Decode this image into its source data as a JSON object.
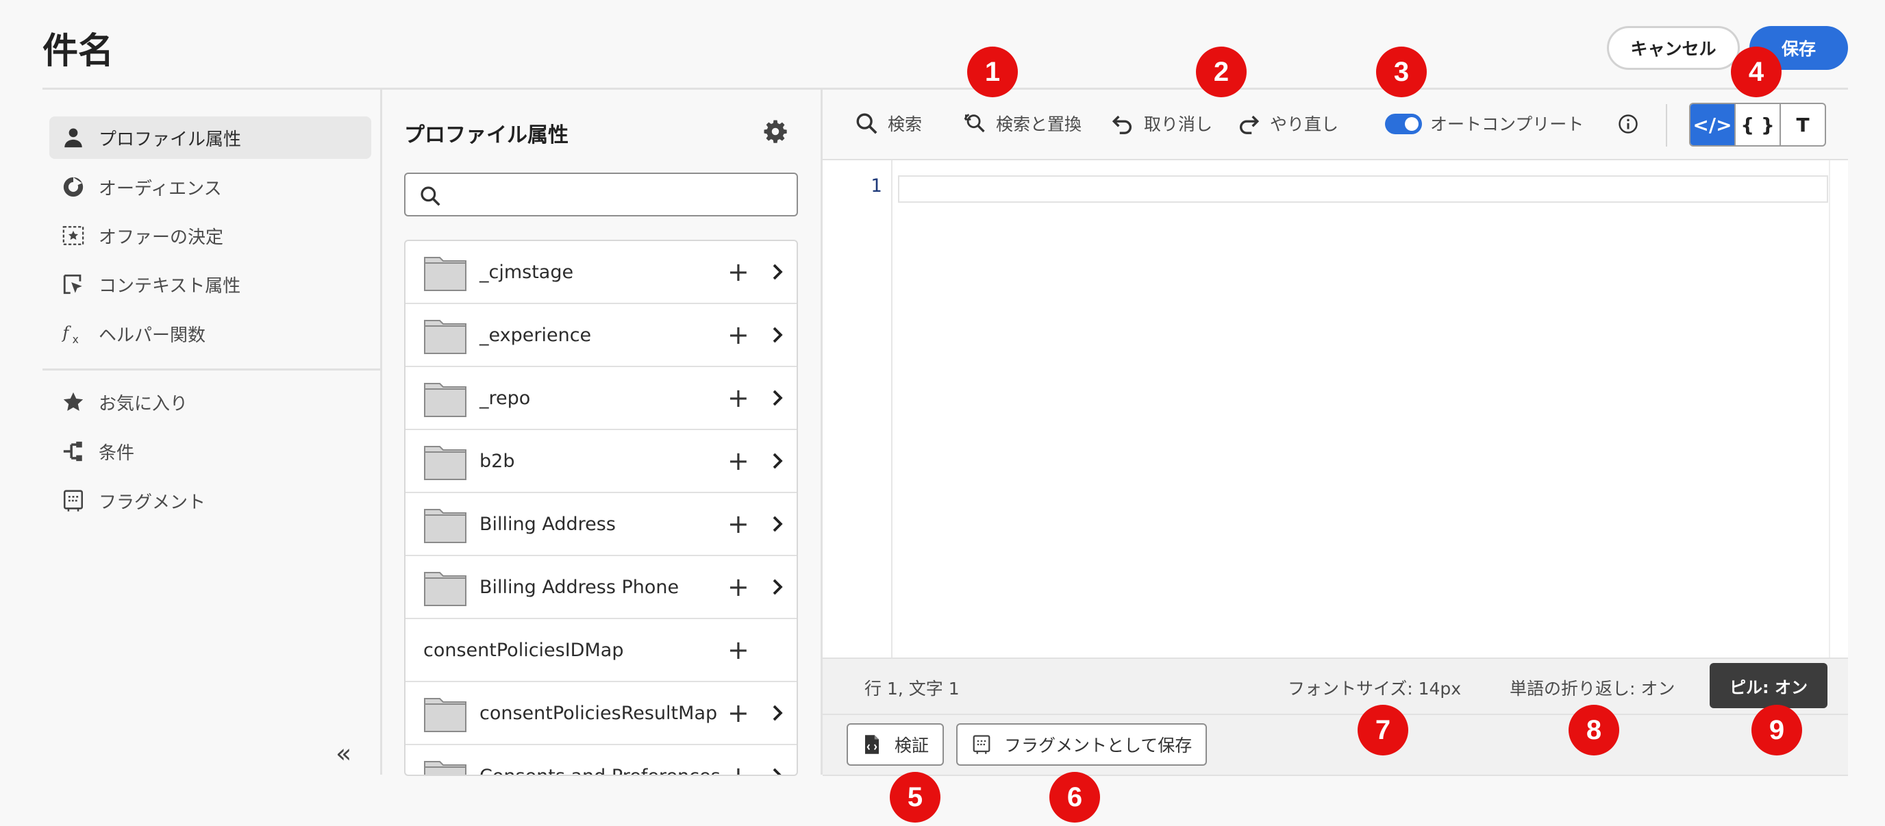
{
  "header": {
    "title": "件名",
    "cancel_label": "キャンセル",
    "save_label": "保存"
  },
  "sidebar": {
    "items": [
      {
        "label": "プロファイル属性",
        "icon": "user-icon"
      },
      {
        "label": "オーディエンス",
        "icon": "audience-icon"
      },
      {
        "label": "オファーの決定",
        "icon": "offer-decision-icon"
      },
      {
        "label": "コンテキスト属性",
        "icon": "context-icon"
      },
      {
        "label": "ヘルパー関数",
        "icon": "function-icon"
      },
      {
        "label": "お気に入り",
        "icon": "star-icon"
      },
      {
        "label": "条件",
        "icon": "condition-icon"
      },
      {
        "label": "フラグメント",
        "icon": "fragment-icon"
      }
    ],
    "collapse_glyph": "«"
  },
  "panel": {
    "title": "プロファイル属性",
    "search_placeholder": "",
    "rows": [
      {
        "label": "_cjmstage"
      },
      {
        "label": "_experience"
      },
      {
        "label": "_repo"
      },
      {
        "label": "b2b"
      },
      {
        "label": "Billing Address"
      },
      {
        "label": "Billing Address Phone"
      },
      {
        "label": "consentPoliciesIDMap"
      },
      {
        "label": "consentPoliciesResultMap"
      },
      {
        "label": "Consents and Preferences"
      }
    ]
  },
  "toolbar": {
    "search": "検索",
    "find_replace": "検索と置換",
    "undo": "取り消し",
    "redo": "やり直し",
    "autocomplete": "オートコンプリート",
    "mode_code": "</>",
    "mode_json": "{ }",
    "mode_text": "T"
  },
  "editor": {
    "line_number": "1"
  },
  "status": {
    "position": "行 1, 文字 1",
    "font_size": "フォントサイズ: 14px",
    "word_wrap": "単語の折り返し: オン",
    "pill": "ピル: オン"
  },
  "footer": {
    "validate": "検証",
    "save_fragment": "フラグメントとして保存"
  },
  "callouts": [
    "1",
    "2",
    "3",
    "4",
    "5",
    "6",
    "7",
    "8",
    "9"
  ],
  "colors": {
    "accent": "#2a6fdb",
    "callout": "#e60f0f"
  }
}
